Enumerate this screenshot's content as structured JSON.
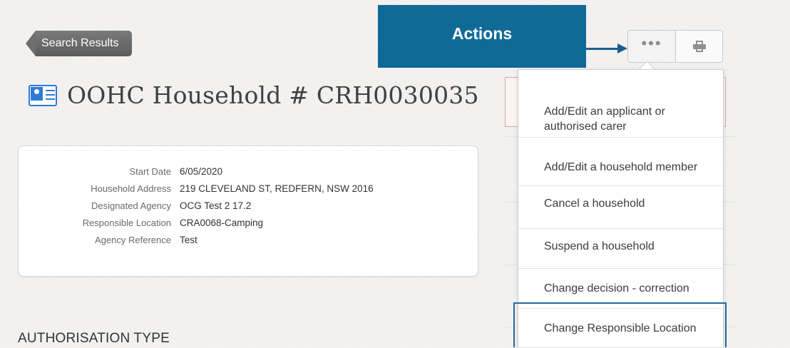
{
  "breadcrumb": {
    "back_label": "Search Results"
  },
  "page": {
    "title": "OOHC Household # CRH0030035",
    "title_icon": "id-card-icon"
  },
  "details": {
    "rows": [
      {
        "label": "Start Date",
        "value": "6/05/2020"
      },
      {
        "label": "Household Address",
        "value": "219 CLEVELAND ST, REDFERN, NSW 2016"
      },
      {
        "label": "Designated Agency",
        "value": "OCG Test 2 17.2"
      },
      {
        "label": "Responsible Location",
        "value": "CRA0068-Camping"
      },
      {
        "label": "Agency Reference",
        "value": "Test"
      }
    ]
  },
  "section": {
    "heading": "AUTHORISATION TYPE"
  },
  "annotation": {
    "label": "Actions",
    "color": "#0f6a98"
  },
  "toolbar": {
    "more_icon": "ellipsis-icon",
    "print_icon": "printer-icon"
  },
  "actions_menu": {
    "items": [
      {
        "label": "Add/Edit an applicant or authorised carer"
      },
      {
        "label": "Add/Edit a household member"
      },
      {
        "label": "Cancel a household"
      },
      {
        "label": "Suspend a household"
      },
      {
        "label": "Change decision - correction"
      },
      {
        "label": "Change Responsible Location"
      }
    ],
    "highlight_color": "#1f6aa5"
  }
}
